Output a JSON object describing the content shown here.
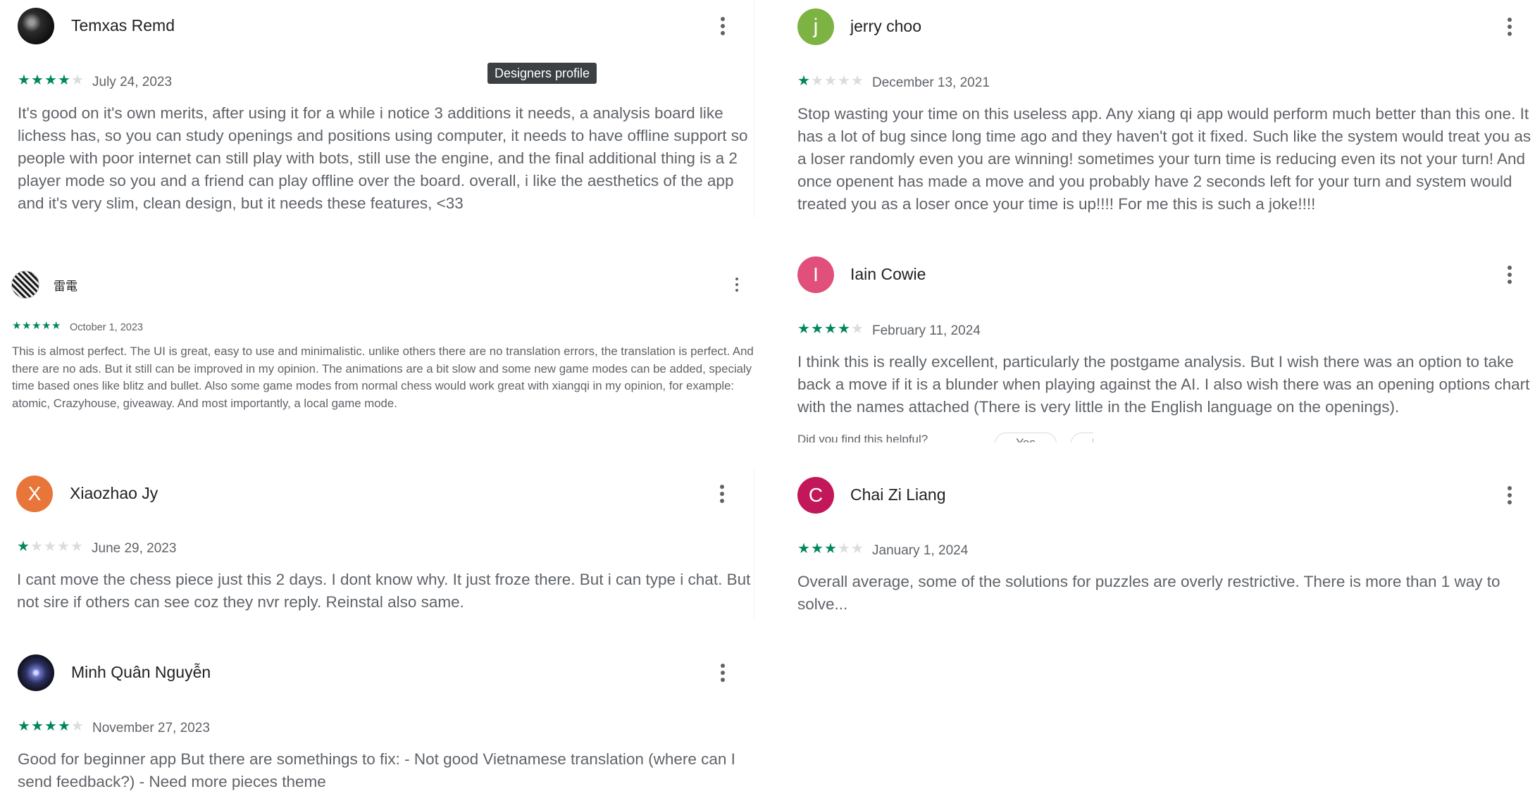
{
  "colors": {
    "star_on": "#01875f",
    "star_off": "#dadce0",
    "author": "#202124",
    "body_text": "#5f6368"
  },
  "tooltip": {
    "label": "Designers profile"
  },
  "reviews": [
    {
      "author": "Temxas Remd",
      "avatar": {
        "type": "photo",
        "color": "#1b1b1b"
      },
      "rating": 4,
      "date": "July 24, 2023",
      "text": "It's good on it's own merits, after using it for a while i notice 3 additions it needs, a analysis board like lichess has, so you can study openings and positions using computer, it needs to have offline support so people with poor internet can still play with bots, still use the engine, and the final additional thing is a 2 player mode so you and a friend can play offline over the board. overall, i like the aesthetics of the app and it's very slim, clean design, but it needs these features, <33"
    },
    {
      "author": "jerry choo",
      "avatar": {
        "type": "letter",
        "letter": "j",
        "color": "#7cb342"
      },
      "rating": 1,
      "date": "December 13, 2021",
      "text": "Stop wasting your time on this useless app. Any xiang qi app would perform much better than this one. It has a lot of bug since long time ago and they haven't got it fixed. Such like the system would treat you as a loser randomly even you are winning! sometimes your turn time is reducing even its not your turn! And once openent has made a move and you probably have 2 seconds left for your turn and system would treated you as a loser once your time is up!!!! For me this is such a joke!!!!"
    },
    {
      "author": "雷電",
      "avatar": {
        "type": "photo",
        "color": "#2a2a2a"
      },
      "rating": 5,
      "date": "October 1, 2023",
      "text": "This is almost perfect. The UI is great, easy to use and minimalistic. unlike others there are no translation errors, the translation is perfect. And there are no ads. But it still can be improved in my opinion. The animations are a bit slow and some new game modes can be added, specialy time based ones like blitz and bullet. Also some game modes from normal chess would work great with xiangqi in my opinion, for example: atomic, Crazyhouse, giveaway. And most importantly, a local game mode."
    },
    {
      "author": "Iain Cowie",
      "avatar": {
        "type": "letter",
        "letter": "I",
        "color": "#e0507a"
      },
      "rating": 4,
      "date": "February 11, 2024",
      "text": "I think this is really excellent, particularly the postgame analysis. But I wish there was an option to take back a move if it is a blunder when playing against the AI. I also wish there was an opening options chart with the names attached (There is very little in the English language on the openings).",
      "helpful": {
        "question": "Did you find this helpful?",
        "yes": "Yes",
        "no": "No"
      }
    },
    {
      "author": "Xiaozhao Jy",
      "avatar": {
        "type": "letter",
        "letter": "X",
        "color": "#e8763a"
      },
      "rating": 1,
      "date": "June 29, 2023",
      "text": "I cant move the chess piece just this 2 days. I dont know why. It just froze there. But i can type i chat. But not sire if others can see coz they nvr reply. Reinstal also same."
    },
    {
      "author": "Chai Zi Liang",
      "avatar": {
        "type": "letter",
        "letter": "C",
        "color": "#c2185b"
      },
      "rating": 3,
      "date": "January 1, 2024",
      "text": "Overall average, some of the solutions for puzzles are overly restrictive. There is more than 1 way to solve..."
    },
    {
      "author": "Minh Quân Nguyễn",
      "avatar": {
        "type": "photo",
        "color": "#1c1c2e"
      },
      "rating": 4,
      "date": "November 27, 2023",
      "text": "Good for beginner app But there are somethings to fix: - Not good Vietnamese translation (where can I send feedback?) - Need more pieces theme"
    }
  ]
}
